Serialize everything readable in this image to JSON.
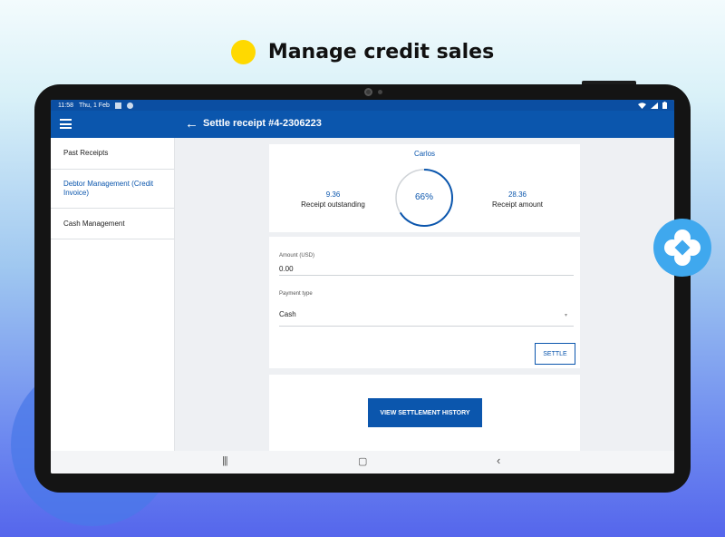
{
  "headline": "Manage credit sales",
  "status_bar": {
    "time": "11:58",
    "date": "Thu, 1 Feb"
  },
  "app_bar": {
    "title": "Settle receipt #4-2306223"
  },
  "sidebar": {
    "items": [
      {
        "label": "Past Receipts",
        "active": false
      },
      {
        "label": "Debtor Management (Credit Invoice)",
        "active": true
      },
      {
        "label": "Cash Management",
        "active": false
      }
    ]
  },
  "summary": {
    "customer": "Carlos",
    "outstanding_value": "9.36",
    "outstanding_label": "Receipt outstanding",
    "percent_label": "66%",
    "percent_value": 0.66,
    "amount_value": "28.36",
    "amount_label": "Receipt amount"
  },
  "form": {
    "amount_label": "Amount (USD)",
    "amount_value": "0.00",
    "payment_type_label": "Payment type",
    "payment_type_value": "Cash",
    "settle_label": "SETTLE"
  },
  "history_button": "VIEW SETTLEMENT HISTORY",
  "nav": {
    "recents": "|||",
    "home": "▢",
    "back": "‹"
  },
  "colors": {
    "primary": "#0b56ad",
    "accent": "#ffd900",
    "logo": "#3fa8ee"
  },
  "icons": [
    "menu-icon",
    "back-arrow-icon",
    "wifi-icon",
    "signal-icon",
    "battery-icon",
    "brand-logo-icon"
  ]
}
